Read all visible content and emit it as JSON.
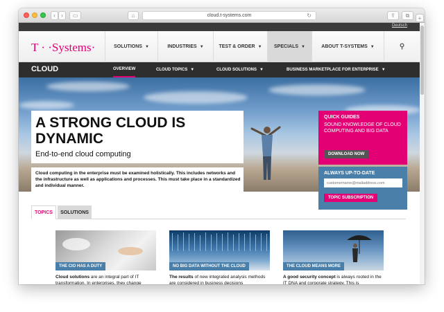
{
  "browser": {
    "url": "cloud.t-systems.com",
    "back_glyph": "‹",
    "forward_glyph": "›",
    "sidebar_glyph": "▭",
    "home_glyph": "⌂",
    "reload_glyph": "↻",
    "share_glyph": "⇪",
    "tabs_glyph": "⧉",
    "newtab_glyph": "+"
  },
  "utility": {
    "language_link": "Deutsch"
  },
  "brand": {
    "logo_text": "T · ·Systems·",
    "color": "#e20074"
  },
  "main_nav": {
    "items": [
      {
        "label": "SOLUTIONS",
        "caret": "▼"
      },
      {
        "label": "INDUSTRIES",
        "caret": "▼"
      },
      {
        "label": "TEST & ORDER",
        "caret": "▼"
      },
      {
        "label": "SPECIALS",
        "caret": "▼"
      },
      {
        "label": "ABOUT T-SYSTEMS",
        "caret": "▼"
      }
    ],
    "search_glyph": "⚲"
  },
  "sub_nav": {
    "section": "CLOUD",
    "items": [
      {
        "label": "OVERVIEW",
        "caret": ""
      },
      {
        "label": "CLOUD TOPICS",
        "caret": "▼"
      },
      {
        "label": "CLOUD SOLUTIONS",
        "caret": "▼"
      },
      {
        "label": "BUSINESS MARKETPLACE FOR ENTERPRISE",
        "caret": "▼"
      }
    ]
  },
  "hero": {
    "headline": "A STRONG CLOUD IS DYNAMIC",
    "subheadline": "End-to-end cloud computing",
    "intro": "Cloud computing in the enterprise must be examined holistically. This includes networks and the infrastructure as well as applications and processes. This must take place in a standardized and individual manner."
  },
  "quick_guides": {
    "title": "QUICK GUIDES",
    "description": "SOUND KNOWLEDGE OF CLOUD COMPUTING AND BIG DATA",
    "button": "DOWNLOAD NOW"
  },
  "subscribe": {
    "title": "ALWAYS UP-TO-DATE",
    "placeholder": "customername@mailaddress.com",
    "button": "TOPIC SUBSCRIPTION"
  },
  "tabs": [
    {
      "label": "TOPICS"
    },
    {
      "label": "SOLUTIONS"
    }
  ],
  "cards": [
    {
      "caption": "THE CIO HAS A DUTY",
      "bold": "Cloud solutions",
      "text": " are an integral part of IT transformation. In enterprises, they change"
    },
    {
      "caption": "NO BIG DATA WITHOUT THE CLOUD",
      "bold": "The results",
      "text": " of new integrated analysis methods are considered in business decisions"
    },
    {
      "caption": "THE CLOUD MEANS MORE",
      "bold": "A good security concept",
      "text": " is always rooted in the IT DNA and corporate strategy. This is"
    }
  ]
}
